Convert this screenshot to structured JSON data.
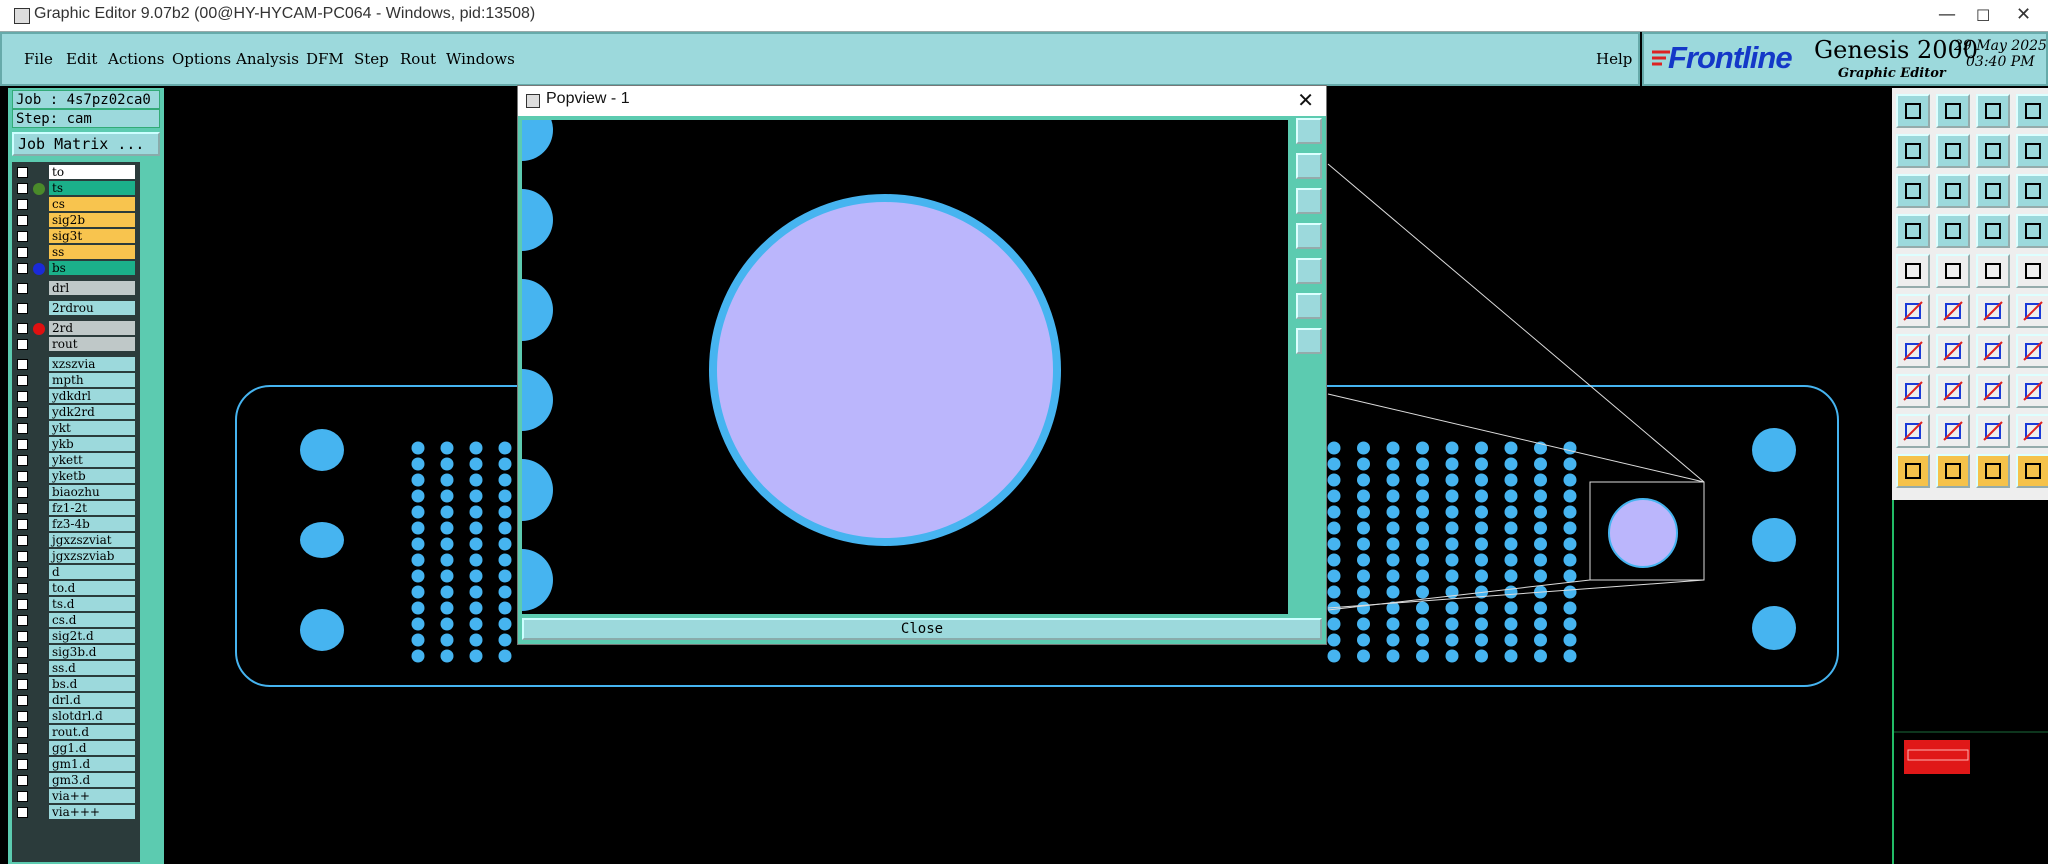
{
  "window": {
    "title": "Graphic Editor 9.07b2 (00@HY-HYCAM-PC064 - Windows, pid:13508)",
    "minimize": "—",
    "maximize": "☐",
    "close": "✕"
  },
  "menu": {
    "items": [
      "File",
      "Edit",
      "Actions",
      "Options",
      "Analysis",
      "DFM",
      "Step",
      "Rout",
      "Windows"
    ],
    "help": "Help"
  },
  "brand": {
    "logo": "Frontline",
    "product": "Genesis 2000",
    "subtitle": "Graphic Editor",
    "date": "29 May 2025",
    "time": "03:40 PM"
  },
  "left": {
    "job": "Job : 4s7pz02ca0",
    "step": "Step: cam",
    "job_matrix": "Job Matrix ..."
  },
  "layers": [
    {
      "name": "to",
      "color": "#ffffff",
      "dot": ""
    },
    {
      "name": "ts",
      "color": "#1bb08a",
      "dot": "#4a8a2a"
    },
    {
      "name": "cs",
      "color": "#f8c44e",
      "dot": ""
    },
    {
      "name": "sig2b",
      "color": "#f8c44e",
      "dot": ""
    },
    {
      "name": "sig3t",
      "color": "#f8c44e",
      "dot": ""
    },
    {
      "name": "ss",
      "color": "#f8c44e",
      "dot": ""
    },
    {
      "name": "bs",
      "color": "#1bb08a",
      "dot": "#1a2ad8"
    },
    {
      "name": "drl",
      "color": "#bfc8c8",
      "dot": ""
    },
    {
      "name": "2rdrou",
      "color": "#9cd9dc",
      "dot": ""
    },
    {
      "name": "2rd",
      "color": "#bfc8c8",
      "dot": "#e01010"
    },
    {
      "name": "rout",
      "color": "#bfc8c8",
      "dot": ""
    },
    {
      "name": "xzszvia",
      "color": "#9cd9dc",
      "dot": ""
    },
    {
      "name": "mpth",
      "color": "#9cd9dc",
      "dot": ""
    },
    {
      "name": "ydkdrl",
      "color": "#9cd9dc",
      "dot": ""
    },
    {
      "name": "ydk2rd",
      "color": "#9cd9dc",
      "dot": ""
    },
    {
      "name": "ykt",
      "color": "#9cd9dc",
      "dot": ""
    },
    {
      "name": "ykb",
      "color": "#9cd9dc",
      "dot": ""
    },
    {
      "name": "ykett",
      "color": "#9cd9dc",
      "dot": ""
    },
    {
      "name": "yketb",
      "color": "#9cd9dc",
      "dot": ""
    },
    {
      "name": "biaozhu",
      "color": "#9cd9dc",
      "dot": ""
    },
    {
      "name": "fz1-2t",
      "color": "#9cd9dc",
      "dot": ""
    },
    {
      "name": "fz3-4b",
      "color": "#9cd9dc",
      "dot": ""
    },
    {
      "name": "jgxzszviat",
      "color": "#9cd9dc",
      "dot": ""
    },
    {
      "name": "jgxzszviab",
      "color": "#9cd9dc",
      "dot": ""
    },
    {
      "name": "d",
      "color": "#9cd9dc",
      "dot": ""
    },
    {
      "name": "to.d",
      "color": "#9cd9dc",
      "dot": ""
    },
    {
      "name": "ts.d",
      "color": "#9cd9dc",
      "dot": ""
    },
    {
      "name": "cs.d",
      "color": "#9cd9dc",
      "dot": ""
    },
    {
      "name": "sig2t.d",
      "color": "#9cd9dc",
      "dot": ""
    },
    {
      "name": "sig3b.d",
      "color": "#9cd9dc",
      "dot": ""
    },
    {
      "name": "ss.d",
      "color": "#9cd9dc",
      "dot": ""
    },
    {
      "name": "bs.d",
      "color": "#9cd9dc",
      "dot": ""
    },
    {
      "name": "drl.d",
      "color": "#9cd9dc",
      "dot": ""
    },
    {
      "name": "slotdrl.d",
      "color": "#9cd9dc",
      "dot": ""
    },
    {
      "name": "rout.d",
      "color": "#9cd9dc",
      "dot": ""
    },
    {
      "name": "gg1.d",
      "color": "#9cd9dc",
      "dot": ""
    },
    {
      "name": "gm1.d",
      "color": "#9cd9dc",
      "dot": ""
    },
    {
      "name": "gm3.d",
      "color": "#9cd9dc",
      "dot": ""
    },
    {
      "name": "via++",
      "color": "#9cd9dc",
      "dot": ""
    },
    {
      "name": "via+++",
      "color": "#9cd9dc",
      "dot": ""
    }
  ],
  "popview": {
    "title": "Popview - 1",
    "close_label": "Close",
    "close_x": "✕"
  },
  "colors": {
    "pad": "#46b4f0",
    "highlight": "#bbb6fc",
    "panel": "#9cd9dc",
    "scroll": "#5ccbb0"
  }
}
